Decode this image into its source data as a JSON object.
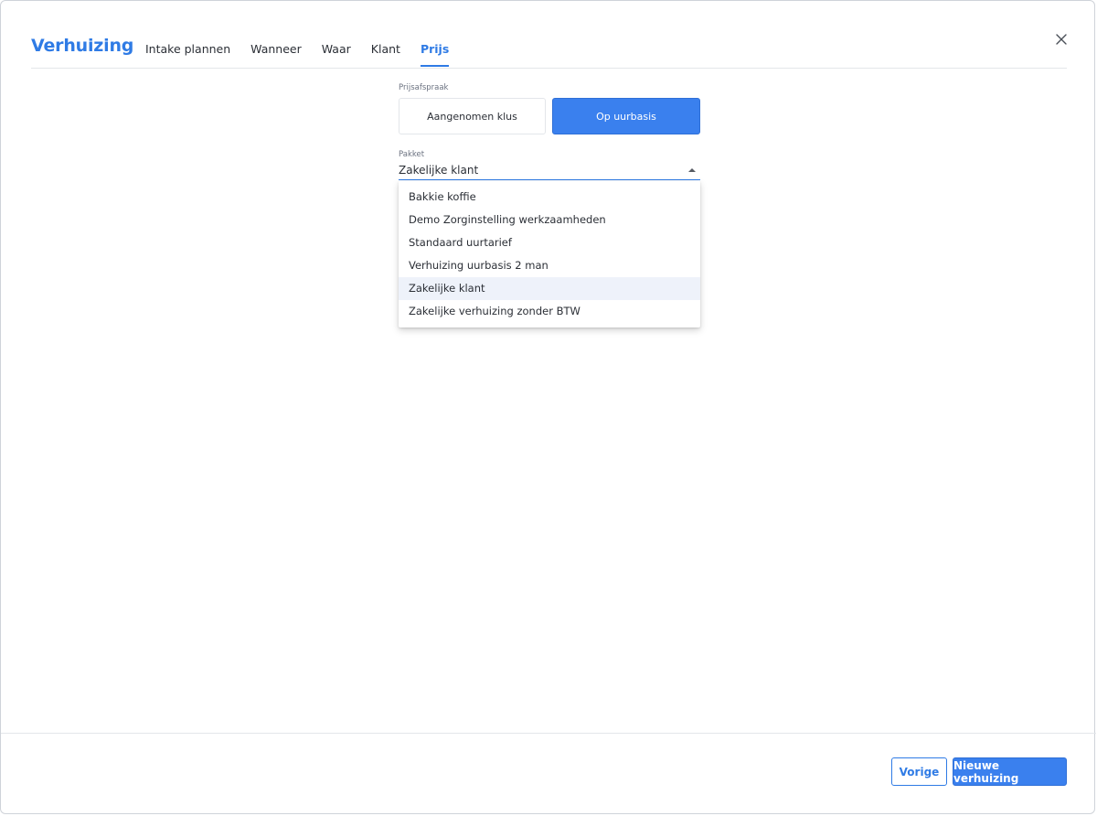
{
  "header": {
    "title": "Verhuizing",
    "tabs": [
      {
        "label": "Intake plannen",
        "active": false
      },
      {
        "label": "Wanneer",
        "active": false
      },
      {
        "label": "Waar",
        "active": false
      },
      {
        "label": "Klant",
        "active": false
      },
      {
        "label": "Prijs",
        "active": true
      }
    ],
    "close_icon": "close-icon"
  },
  "price_agreement": {
    "label": "Prijsafspraak",
    "options": [
      "Aangenomen klus",
      "Op uurbasis"
    ],
    "selected": "Op uurbasis"
  },
  "package": {
    "label": "Pakket",
    "value": "Zakelijke klant",
    "options": [
      "Bakkie koffie",
      "Demo Zorginstelling werkzaamheden",
      "Standaard uurtarief",
      "Verhuizing uurbasis 2 man",
      "Zakelijke klant",
      "Zakelijke verhuizing zonder BTW"
    ]
  },
  "footer": {
    "back_label": "Vorige",
    "submit_label": "Nieuwe verhuizing"
  },
  "colors": {
    "accent": "#3a80ee",
    "title": "#2f7be5",
    "highlight": "#eef2fa"
  }
}
